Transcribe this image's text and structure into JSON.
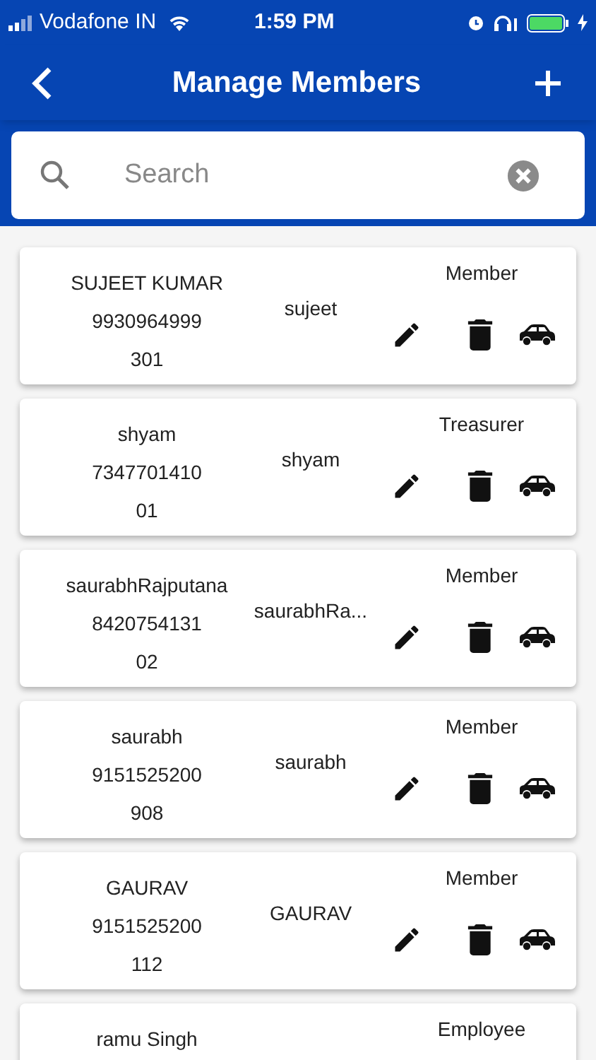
{
  "status_bar": {
    "carrier": "Vodafone IN",
    "time": "1:59 PM"
  },
  "header": {
    "title": "Manage Members"
  },
  "search": {
    "placeholder": "Search"
  },
  "members": [
    {
      "name": "SUJEET KUMAR",
      "phone": "9930964999",
      "unit": "301",
      "username": "sujeet",
      "role": "Member"
    },
    {
      "name": "shyam",
      "phone": "7347701410",
      "unit": "01",
      "username": "shyam",
      "role": "Treasurer"
    },
    {
      "name": "saurabhRajputana",
      "phone": "8420754131",
      "unit": "02",
      "username": "saurabhRa...",
      "role": "Member"
    },
    {
      "name": "saurabh",
      "phone": "9151525200",
      "unit": "908",
      "username": "saurabh",
      "role": "Member"
    },
    {
      "name": "GAURAV",
      "phone": "9151525200",
      "unit": "112",
      "username": "GAURAV",
      "role": "Member"
    },
    {
      "name": "ramu Singh",
      "role": "Employee"
    }
  ]
}
